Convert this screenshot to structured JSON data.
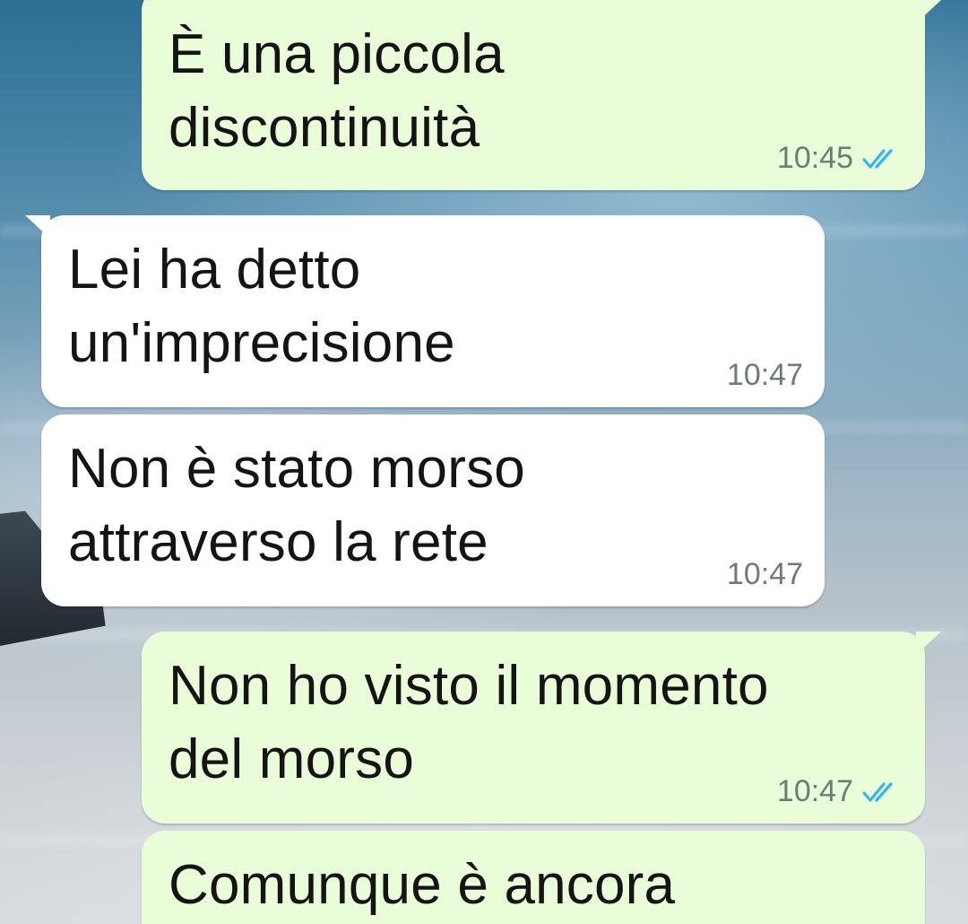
{
  "chat": {
    "messages": [
      {
        "direction": "out",
        "text": "È una piccola\ndiscontinuità",
        "time": "10:45",
        "status_icon": "double-check-read-icon"
      },
      {
        "direction": "in",
        "text": "Lei ha detto\nun'imprecisione",
        "time": "10:47"
      },
      {
        "direction": "in",
        "text": "Non è stato morso\nattraverso la rete",
        "time": "10:47"
      },
      {
        "direction": "out",
        "text": "Non ho visto il momento\ndel morso",
        "time": "10:47",
        "status_icon": "double-check-read-icon"
      },
      {
        "direction": "out",
        "text": "Comunque è ancora",
        "time": ""
      }
    ]
  },
  "colors": {
    "outgoing_bubble": "#e9fdd8",
    "incoming_bubble": "#ffffff",
    "read_ticks": "#34b7f1",
    "timestamp": "#6f7b74"
  }
}
